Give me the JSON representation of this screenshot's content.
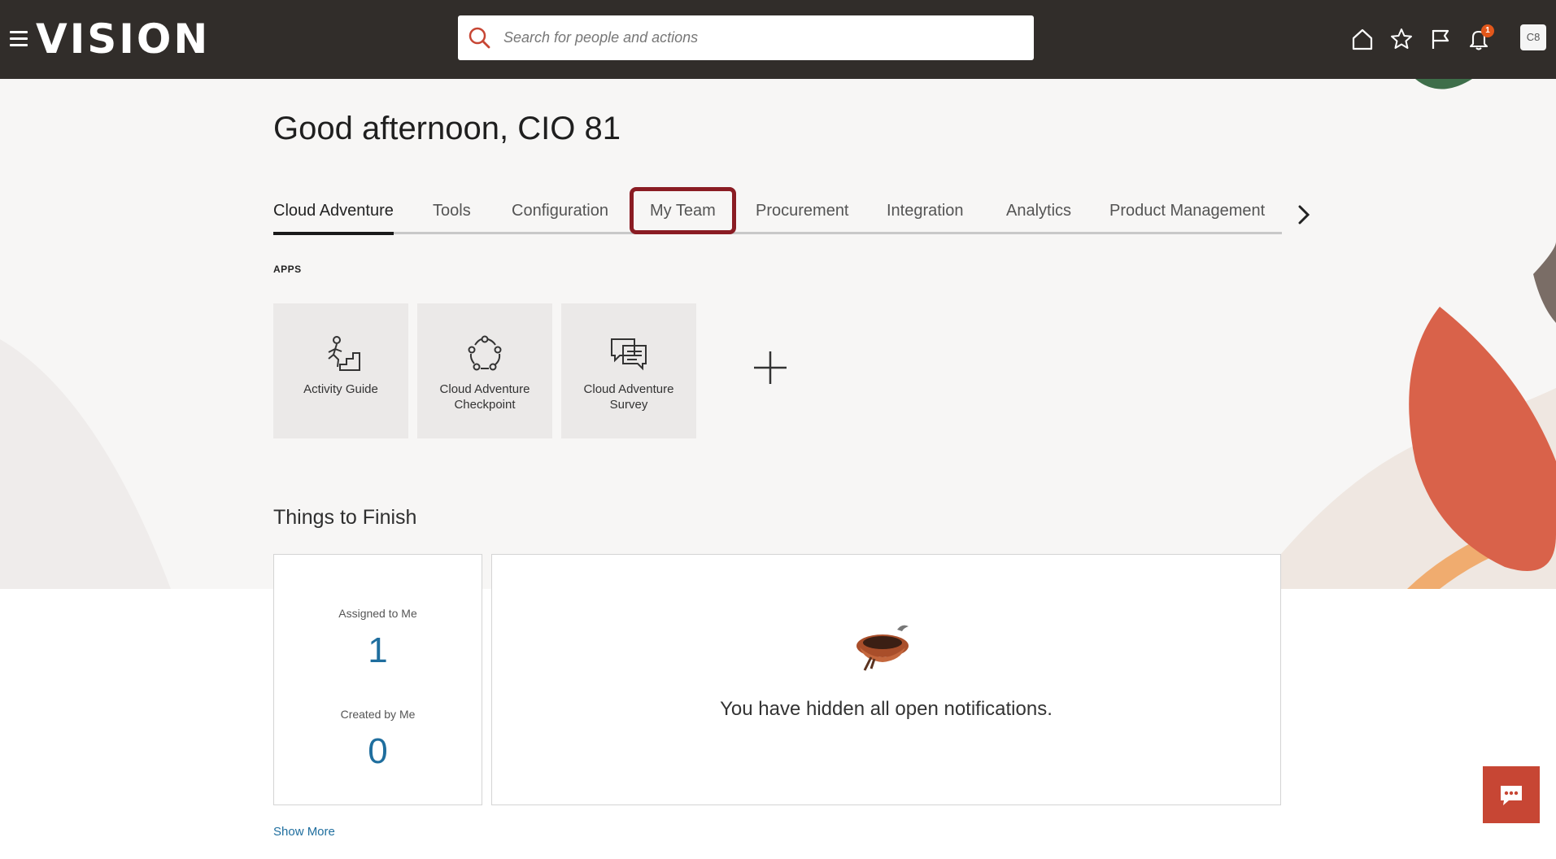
{
  "header": {
    "brand": "VISION",
    "search_placeholder": "Search for people and actions",
    "notification_count": "1",
    "user_initials": "C8"
  },
  "greeting": "Good afternoon, CIO 81",
  "tabs": [
    {
      "label": "Cloud Adventure",
      "active": true
    },
    {
      "label": "Tools"
    },
    {
      "label": "Configuration"
    },
    {
      "label": "My Team",
      "highlighted": true
    },
    {
      "label": "Procurement"
    },
    {
      "label": "Integration"
    },
    {
      "label": "Analytics"
    },
    {
      "label": "Product Management"
    }
  ],
  "apps": {
    "section_label": "APPS",
    "tiles": [
      {
        "label": "Activity Guide",
        "icon": "activity-guide-icon"
      },
      {
        "label": "Cloud Adventure Checkpoint",
        "icon": "checkpoint-icon"
      },
      {
        "label": "Cloud Adventure Survey",
        "icon": "survey-icon"
      }
    ],
    "add_icon": "plus-icon"
  },
  "things_to_finish": {
    "title": "Things to Finish",
    "assigned_label": "Assigned to Me",
    "assigned_count": "1",
    "created_label": "Created by Me",
    "created_count": "0",
    "notification_message": "You have hidden all open notifications.",
    "show_more": "Show More"
  },
  "colors": {
    "header_bg": "#312d2a",
    "link": "#1f6e9e",
    "highlight_border": "#8a1c23",
    "accent": "#c74634"
  }
}
